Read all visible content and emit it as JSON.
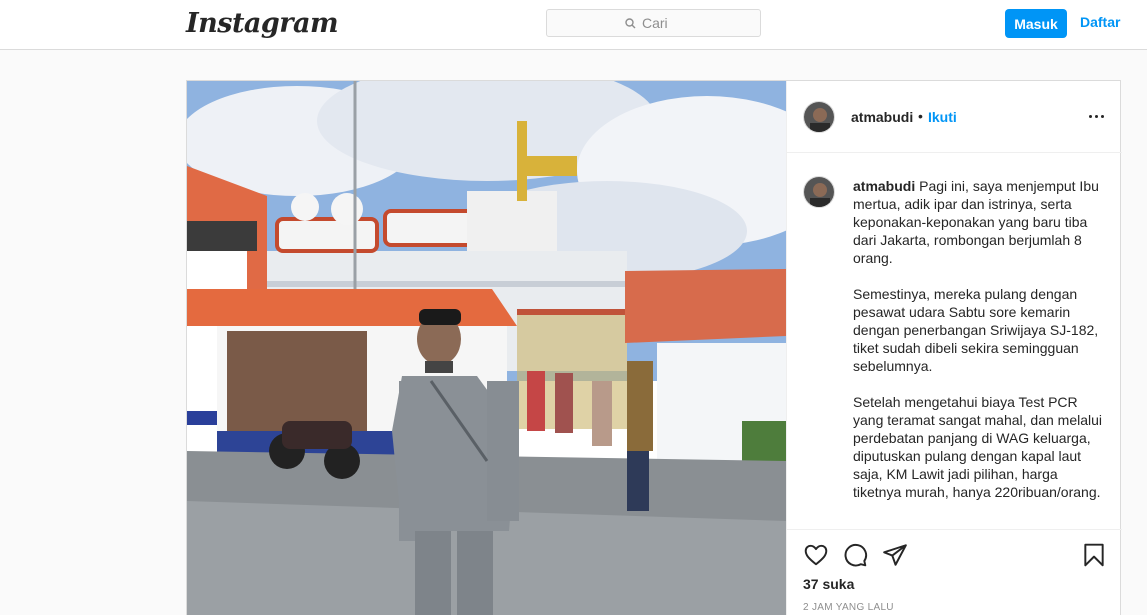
{
  "header": {
    "logo": "Instagram",
    "search": {
      "placeholder": "Cari"
    },
    "login_label": "Masuk",
    "signup_label": "Daftar"
  },
  "colors": {
    "accent": "#0095f6",
    "text": "#262626",
    "muted": "#8e8e8e",
    "border": "#dbdbdb",
    "page_bg": "#fafafa"
  },
  "post": {
    "image_icon": "post-photo",
    "author": {
      "username": "atmabudi",
      "separator": "•",
      "follow_label": "Ikuti",
      "avatar_icon": "avatar"
    },
    "more_icon": "more-options-icon",
    "caption": {
      "username": "atmabudi",
      "paragraphs": [
        "Pagi ini, saya menjemput Ibu mertua, adik ipar dan istrinya, serta keponakan-keponakan yang baru tiba dari Jakarta, rombongan berjumlah 8 orang.",
        "Semestinya, mereka pulang dengan pesawat udara Sabtu sore kemarin dengan penerbangan Sriwijaya SJ-182, tiket sudah dibeli sekira semingguan sebelumnya.",
        "Setelah mengetahui biaya Test PCR yang teramat sangat mahal, dan melalui perdebatan panjang di WAG keluarga, diputuskan pulang dengan kapal laut saja, KM Lawit jadi pilihan, harga tiketnya murah, hanya 220ribuan/orang."
      ]
    },
    "actions": {
      "like_icon": "heart-icon",
      "comment_icon": "comment-icon",
      "share_icon": "share-icon",
      "save_icon": "bookmark-icon"
    },
    "likes": "37 suka",
    "timestamp": "2 JAM YANG LALU"
  }
}
